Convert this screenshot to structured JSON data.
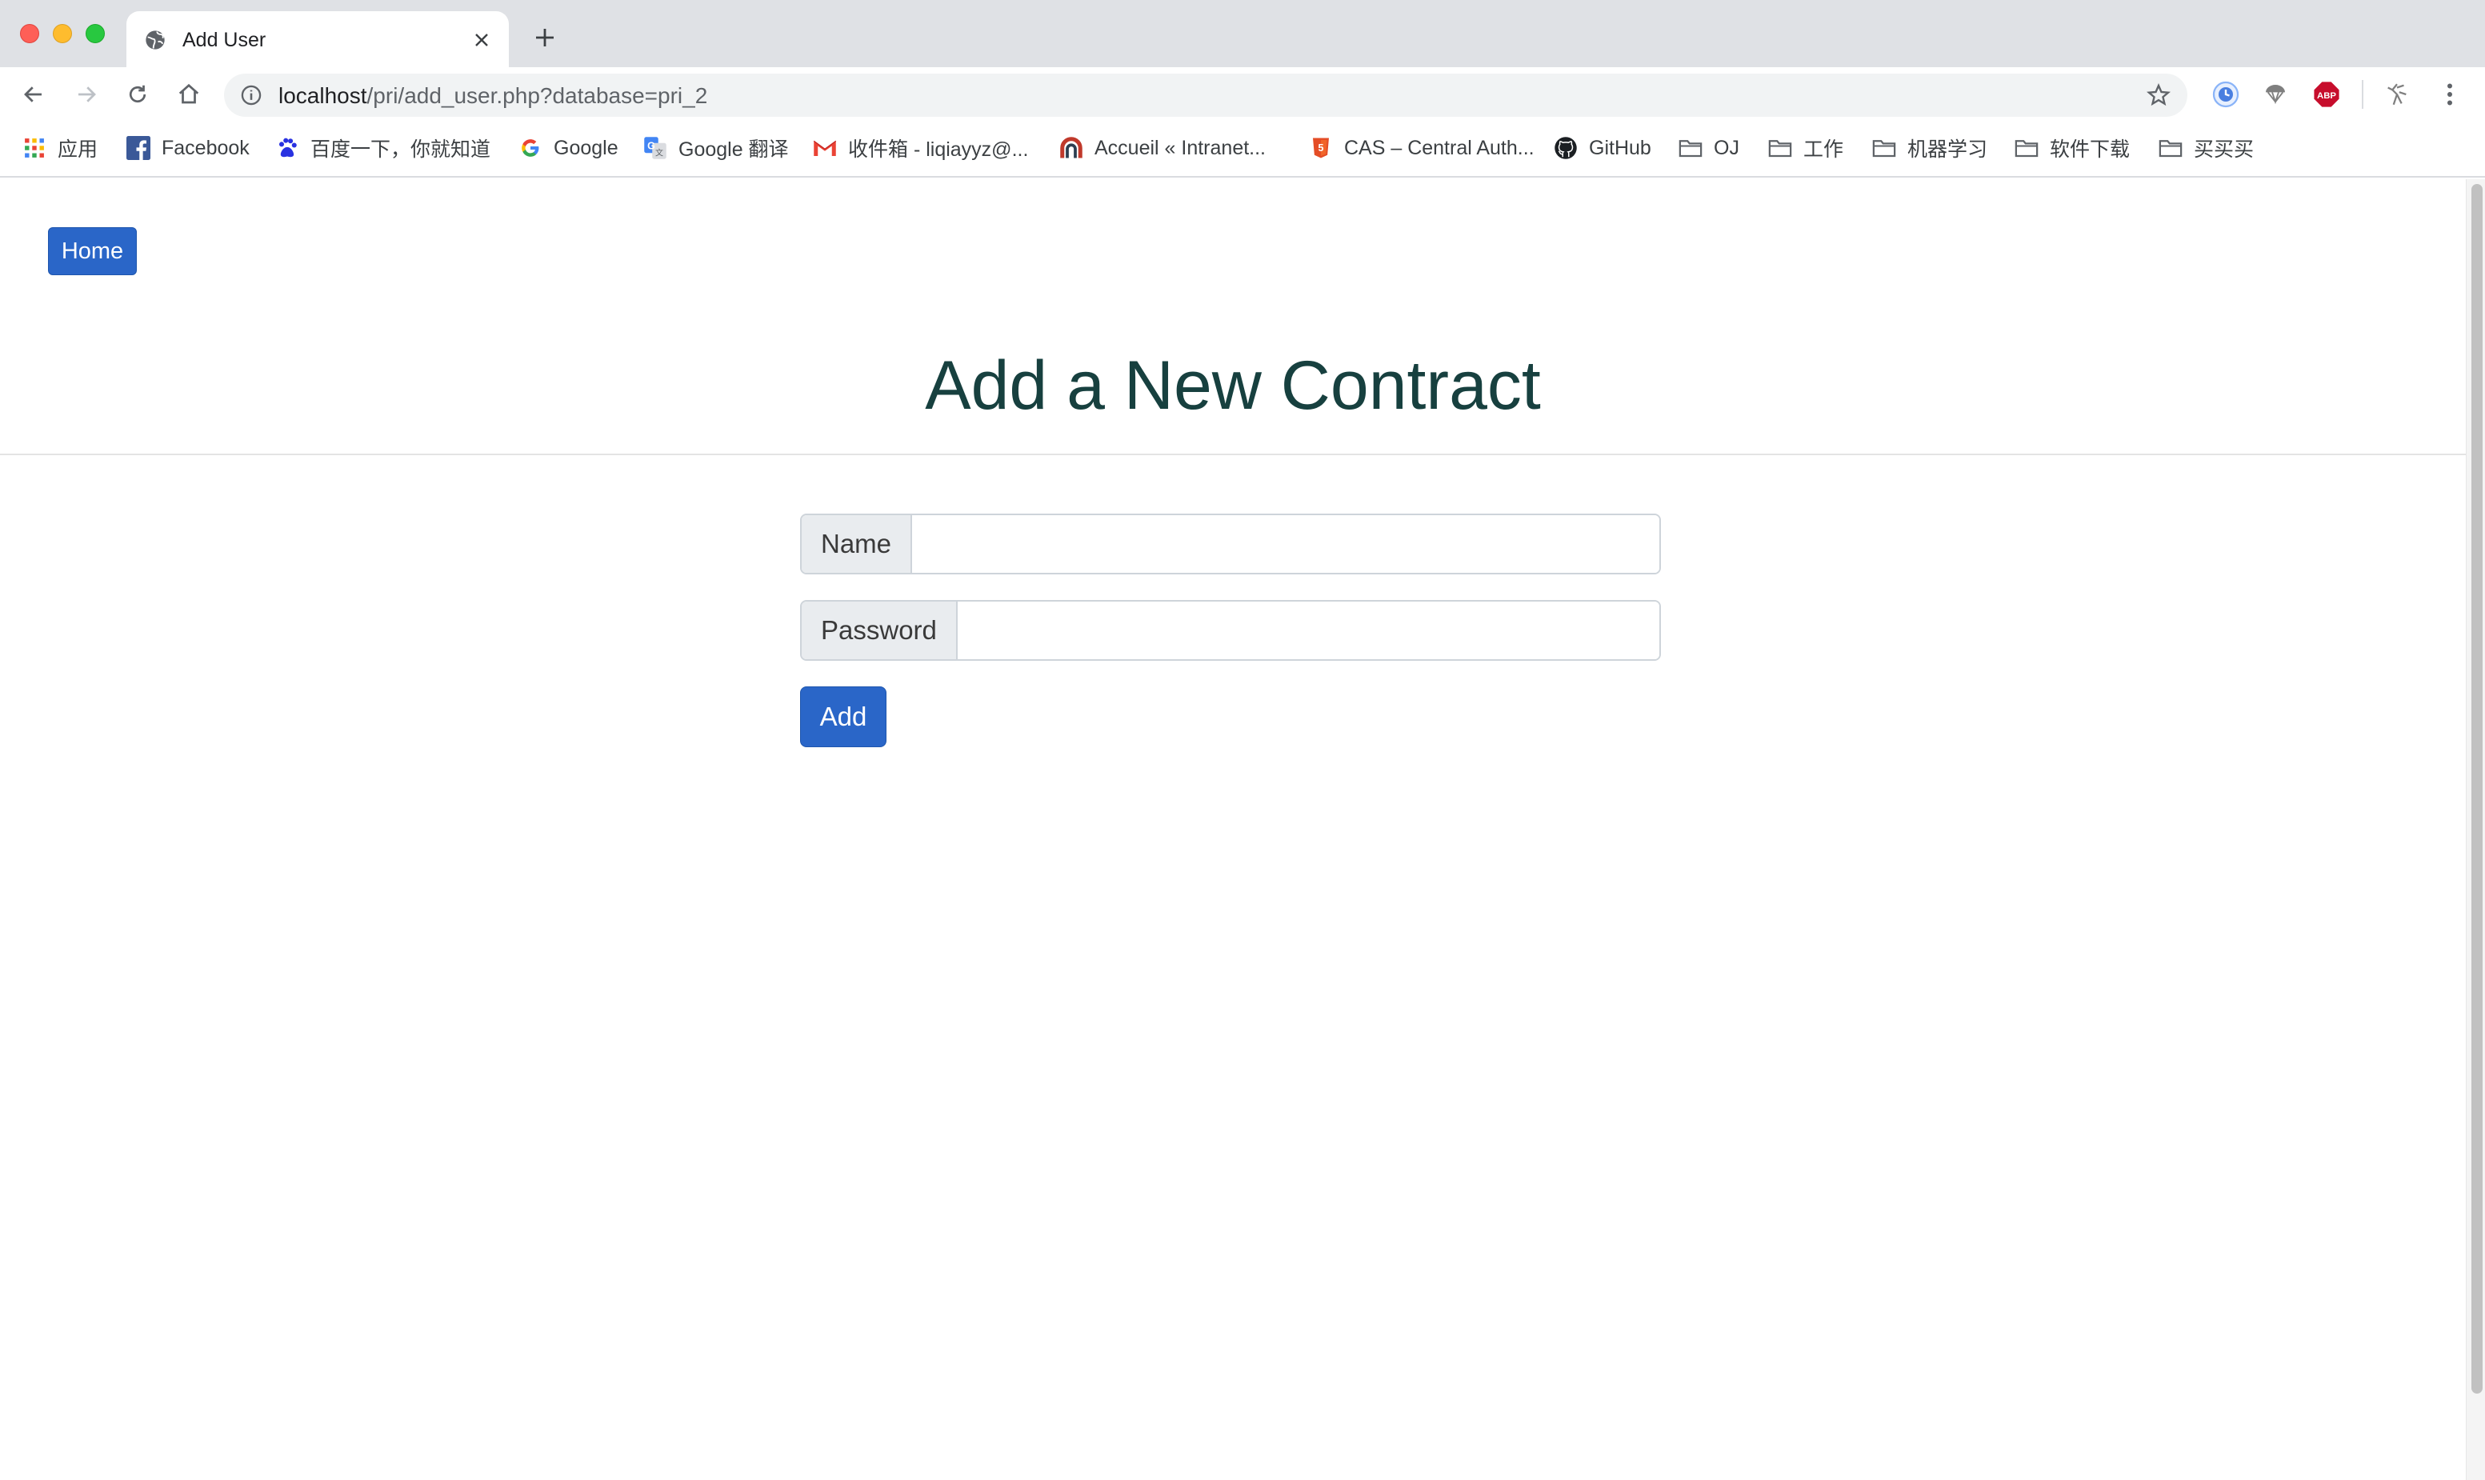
{
  "browser": {
    "tab_title": "Add User",
    "url_host": "localhost",
    "url_path": "/pri/add_user.php?database=pri_2"
  },
  "bookmarks": [
    {
      "label": "应用",
      "icon": "apps-grid-icon"
    },
    {
      "label": "Facebook",
      "icon": "facebook-icon"
    },
    {
      "label": "百度一下，你就知道",
      "icon": "baidu-paw-icon"
    },
    {
      "label": "Google",
      "icon": "google-g-icon"
    },
    {
      "label": "Google 翻译",
      "icon": "google-translate-icon"
    },
    {
      "label": "收件箱 - liqiayyz@...",
      "icon": "gmail-icon"
    },
    {
      "label": "Accueil « Intranet...",
      "icon": "intranet-icon"
    },
    {
      "label": "CAS – Central Auth...",
      "icon": "cas-shield-icon"
    },
    {
      "label": "GitHub",
      "icon": "github-icon"
    },
    {
      "label": "OJ",
      "icon": "folder-icon"
    },
    {
      "label": "工作",
      "icon": "folder-icon"
    },
    {
      "label": "机器学习",
      "icon": "folder-icon"
    },
    {
      "label": "软件下载",
      "icon": "folder-icon"
    },
    {
      "label": "买买买",
      "icon": "folder-icon"
    }
  ],
  "page": {
    "home_label": "Home",
    "title": "Add a New Contract",
    "name_label": "Name",
    "name_value": "",
    "password_label": "Password",
    "password_value": "",
    "add_label": "Add"
  },
  "colors": {
    "primary": "#2a66c8",
    "title": "#17403f",
    "input_addon_bg": "#e9ecef"
  }
}
